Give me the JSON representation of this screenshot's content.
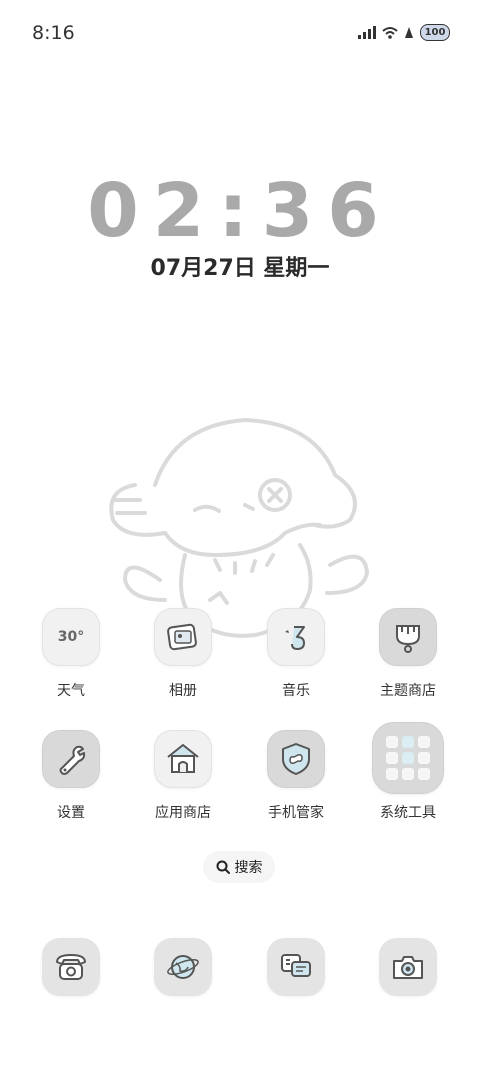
{
  "status_bar": {
    "time": "8:16",
    "battery": "100",
    "icons": [
      "signal-icon",
      "wifi-icon",
      "notification-icon",
      "battery-icon"
    ]
  },
  "lockscreen_clock": {
    "time": "02:36",
    "date": "07月27日 星期一"
  },
  "apps_row1": [
    {
      "label": "天气",
      "icon": "weather-icon",
      "icon_text": "30°"
    },
    {
      "label": "相册",
      "icon": "gallery-icon"
    },
    {
      "label": "音乐",
      "icon": "music-icon"
    },
    {
      "label": "主题商店",
      "icon": "theme-store-icon"
    }
  ],
  "apps_row2": [
    {
      "label": "设置",
      "icon": "settings-icon"
    },
    {
      "label": "应用商店",
      "icon": "app-store-icon"
    },
    {
      "label": "手机管家",
      "icon": "phone-manager-icon"
    },
    {
      "label": "系统工具",
      "icon": "system-tools-folder-icon"
    }
  ],
  "search": {
    "label": "搜索"
  },
  "dock": [
    {
      "icon": "phone-icon"
    },
    {
      "icon": "browser-icon"
    },
    {
      "icon": "messages-icon"
    },
    {
      "icon": "camera-icon"
    }
  ],
  "colors": {
    "clock": "#a9a9a9",
    "accent_teal": "#7fb7c9",
    "background": "#ffffff"
  }
}
